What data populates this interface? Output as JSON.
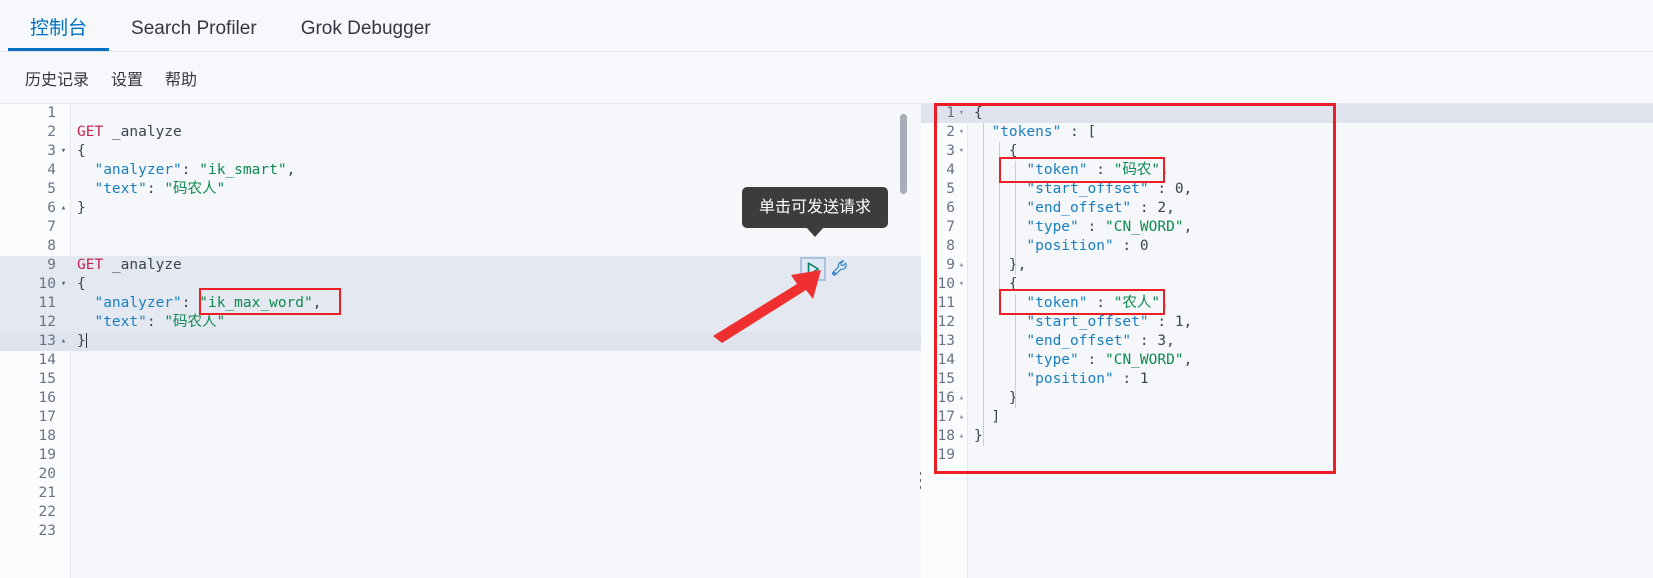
{
  "tabs": [
    {
      "label": "控制台",
      "active": true
    },
    {
      "label": "Search Profiler",
      "active": false
    },
    {
      "label": "Grok Debugger",
      "active": false
    }
  ],
  "menu": [
    {
      "label": "历史记录"
    },
    {
      "label": "设置"
    },
    {
      "label": "帮助"
    }
  ],
  "tooltip": {
    "text": "单击可发送请求"
  },
  "colors": {
    "accent": "#0071c2",
    "annotation": "#ec2024",
    "string": "#0f8a4f",
    "key": "#1a7fc1",
    "method": "#c7254e",
    "tooltip_bg": "#3c3c3c"
  },
  "editor": {
    "name": "request-editor",
    "line_numbers": [
      "1",
      "2",
      "3",
      "4",
      "5",
      "6",
      "7",
      "8",
      "9",
      "10",
      "11",
      "12",
      "13",
      "14",
      "15",
      "16",
      "17",
      "18",
      "19",
      "20",
      "21",
      "22",
      "23"
    ],
    "folds": [
      "",
      "",
      "▾",
      "",
      "",
      "▴",
      "",
      "",
      "",
      "▾",
      "",
      "",
      "▴",
      "",
      "",
      "",
      "",
      "",
      "",
      "",
      "",
      "",
      ""
    ],
    "lines": [
      {
        "n": "1",
        "fold": "",
        "tokens": []
      },
      {
        "n": "2",
        "fold": "",
        "tokens": [
          {
            "t": "GET",
            "c": "k-method"
          },
          {
            "t": " _analyze",
            "c": "k-url"
          }
        ]
      },
      {
        "n": "3",
        "fold": "▾",
        "tokens": [
          {
            "t": "{",
            "c": "k-punct"
          }
        ]
      },
      {
        "n": "4",
        "fold": "",
        "tokens": [
          {
            "t": "  ",
            "c": "k-punct"
          },
          {
            "t": "\"analyzer\"",
            "c": "k-key"
          },
          {
            "t": ": ",
            "c": "k-punct"
          },
          {
            "t": "\"ik_smart\"",
            "c": "k-str"
          },
          {
            "t": ",",
            "c": "k-punct"
          }
        ]
      },
      {
        "n": "5",
        "fold": "",
        "tokens": [
          {
            "t": "  ",
            "c": "k-punct"
          },
          {
            "t": "\"text\"",
            "c": "k-key"
          },
          {
            "t": ": ",
            "c": "k-punct"
          },
          {
            "t": "\"码农人\"",
            "c": "k-str"
          }
        ]
      },
      {
        "n": "6",
        "fold": "▴",
        "tokens": [
          {
            "t": "}",
            "c": "k-punct"
          }
        ]
      },
      {
        "n": "7",
        "fold": "",
        "tokens": []
      },
      {
        "n": "8",
        "fold": "",
        "tokens": []
      },
      {
        "n": "9",
        "fold": "",
        "tokens": [
          {
            "t": "GET",
            "c": "k-method"
          },
          {
            "t": " _analyze",
            "c": "k-url"
          }
        ],
        "sel": true
      },
      {
        "n": "10",
        "fold": "▾",
        "tokens": [
          {
            "t": "{",
            "c": "k-punct"
          }
        ],
        "sel": true
      },
      {
        "n": "11",
        "fold": "",
        "tokens": [
          {
            "t": "  ",
            "c": "k-punct"
          },
          {
            "t": "\"analyzer\"",
            "c": "k-key"
          },
          {
            "t": ": ",
            "c": "k-punct"
          },
          {
            "t": "\"ik_max_word\"",
            "c": "k-str"
          },
          {
            "t": ",",
            "c": "k-punct"
          }
        ],
        "sel": true
      },
      {
        "n": "12",
        "fold": "",
        "tokens": [
          {
            "t": "  ",
            "c": "k-punct"
          },
          {
            "t": "\"text\"",
            "c": "k-key"
          },
          {
            "t": ": ",
            "c": "k-punct"
          },
          {
            "t": "\"码农人\"",
            "c": "k-str"
          }
        ],
        "sel": true
      },
      {
        "n": "13",
        "fold": "▴",
        "tokens": [
          {
            "t": "}",
            "c": "k-punct"
          }
        ],
        "cur": true,
        "caret": true
      },
      {
        "n": "14",
        "fold": "",
        "tokens": []
      },
      {
        "n": "15",
        "fold": "",
        "tokens": []
      },
      {
        "n": "16",
        "fold": "",
        "tokens": []
      },
      {
        "n": "17",
        "fold": "",
        "tokens": []
      },
      {
        "n": "18",
        "fold": "",
        "tokens": []
      },
      {
        "n": "19",
        "fold": "",
        "tokens": []
      },
      {
        "n": "20",
        "fold": "",
        "tokens": []
      },
      {
        "n": "21",
        "fold": "",
        "tokens": []
      },
      {
        "n": "22",
        "fold": "",
        "tokens": []
      },
      {
        "n": "23",
        "fold": "",
        "tokens": []
      }
    ]
  },
  "output": {
    "name": "response-viewer",
    "lines": [
      {
        "n": "1",
        "fold": "▾",
        "tokens": [
          {
            "t": "{",
            "c": "k-punct"
          }
        ],
        "cur": true
      },
      {
        "n": "2",
        "fold": "▾",
        "tokens": [
          {
            "t": "  ",
            "c": "k-punct"
          },
          {
            "t": "\"tokens\"",
            "c": "k-key"
          },
          {
            "t": " : ",
            "c": "k-punct"
          },
          {
            "t": "[",
            "c": "k-punct"
          }
        ]
      },
      {
        "n": "3",
        "fold": "▾",
        "tokens": [
          {
            "t": "    ",
            "c": "k-punct"
          },
          {
            "t": "{",
            "c": "k-punct"
          }
        ]
      },
      {
        "n": "4",
        "fold": "",
        "tokens": [
          {
            "t": "      ",
            "c": "k-punct"
          },
          {
            "t": "\"token\"",
            "c": "k-key"
          },
          {
            "t": " : ",
            "c": "k-punct"
          },
          {
            "t": "\"码农\"",
            "c": "k-str"
          },
          {
            "t": ",",
            "c": "k-punct"
          }
        ]
      },
      {
        "n": "5",
        "fold": "",
        "tokens": [
          {
            "t": "      ",
            "c": "k-punct"
          },
          {
            "t": "\"start_offset\"",
            "c": "k-key"
          },
          {
            "t": " : ",
            "c": "k-punct"
          },
          {
            "t": "0",
            "c": "k-num"
          },
          {
            "t": ",",
            "c": "k-punct"
          }
        ]
      },
      {
        "n": "6",
        "fold": "",
        "tokens": [
          {
            "t": "      ",
            "c": "k-punct"
          },
          {
            "t": "\"end_offset\"",
            "c": "k-key"
          },
          {
            "t": " : ",
            "c": "k-punct"
          },
          {
            "t": "2",
            "c": "k-num"
          },
          {
            "t": ",",
            "c": "k-punct"
          }
        ]
      },
      {
        "n": "7",
        "fold": "",
        "tokens": [
          {
            "t": "      ",
            "c": "k-punct"
          },
          {
            "t": "\"type\"",
            "c": "k-key"
          },
          {
            "t": " : ",
            "c": "k-punct"
          },
          {
            "t": "\"CN_WORD\"",
            "c": "k-str"
          },
          {
            "t": ",",
            "c": "k-punct"
          }
        ]
      },
      {
        "n": "8",
        "fold": "",
        "tokens": [
          {
            "t": "      ",
            "c": "k-punct"
          },
          {
            "t": "\"position\"",
            "c": "k-key"
          },
          {
            "t": " : ",
            "c": "k-punct"
          },
          {
            "t": "0",
            "c": "k-num"
          }
        ]
      },
      {
        "n": "9",
        "fold": "▴",
        "tokens": [
          {
            "t": "    ",
            "c": "k-punct"
          },
          {
            "t": "},",
            "c": "k-punct"
          }
        ]
      },
      {
        "n": "10",
        "fold": "▾",
        "tokens": [
          {
            "t": "    ",
            "c": "k-punct"
          },
          {
            "t": "{",
            "c": "k-punct"
          }
        ]
      },
      {
        "n": "11",
        "fold": "",
        "tokens": [
          {
            "t": "      ",
            "c": "k-punct"
          },
          {
            "t": "\"token\"",
            "c": "k-key"
          },
          {
            "t": " : ",
            "c": "k-punct"
          },
          {
            "t": "\"农人\"",
            "c": "k-str"
          },
          {
            "t": ",",
            "c": "k-punct"
          }
        ]
      },
      {
        "n": "12",
        "fold": "",
        "tokens": [
          {
            "t": "      ",
            "c": "k-punct"
          },
          {
            "t": "\"start_offset\"",
            "c": "k-key"
          },
          {
            "t": " : ",
            "c": "k-punct"
          },
          {
            "t": "1",
            "c": "k-num"
          },
          {
            "t": ",",
            "c": "k-punct"
          }
        ]
      },
      {
        "n": "13",
        "fold": "",
        "tokens": [
          {
            "t": "      ",
            "c": "k-punct"
          },
          {
            "t": "\"end_offset\"",
            "c": "k-key"
          },
          {
            "t": " : ",
            "c": "k-punct"
          },
          {
            "t": "3",
            "c": "k-num"
          },
          {
            "t": ",",
            "c": "k-punct"
          }
        ]
      },
      {
        "n": "14",
        "fold": "",
        "tokens": [
          {
            "t": "      ",
            "c": "k-punct"
          },
          {
            "t": "\"type\"",
            "c": "k-key"
          },
          {
            "t": " : ",
            "c": "k-punct"
          },
          {
            "t": "\"CN_WORD\"",
            "c": "k-str"
          },
          {
            "t": ",",
            "c": "k-punct"
          }
        ]
      },
      {
        "n": "15",
        "fold": "",
        "tokens": [
          {
            "t": "      ",
            "c": "k-punct"
          },
          {
            "t": "\"position\"",
            "c": "k-key"
          },
          {
            "t": " : ",
            "c": "k-punct"
          },
          {
            "t": "1",
            "c": "k-num"
          }
        ]
      },
      {
        "n": "16",
        "fold": "▴",
        "tokens": [
          {
            "t": "    ",
            "c": "k-punct"
          },
          {
            "t": "}",
            "c": "k-punct"
          }
        ]
      },
      {
        "n": "17",
        "fold": "▴",
        "tokens": [
          {
            "t": "  ",
            "c": "k-punct"
          },
          {
            "t": "]",
            "c": "k-punct"
          }
        ]
      },
      {
        "n": "18",
        "fold": "▴",
        "tokens": [
          {
            "t": "}",
            "c": "k-punct"
          }
        ]
      },
      {
        "n": "19",
        "fold": "",
        "tokens": []
      }
    ]
  },
  "annotations": {
    "box_analyzer_value": {
      "label": "ik_max_word"
    },
    "box_token_1": {
      "label": "token 码农"
    },
    "box_token_2": {
      "label": "token 农人"
    },
    "box_response": {
      "label": "response-json"
    },
    "arrow": {
      "label": "points-to-run-button"
    }
  },
  "icons": {
    "run": "play-triangle-icon",
    "wrench": "wrench-icon",
    "drag": "drag-handle-icon"
  }
}
